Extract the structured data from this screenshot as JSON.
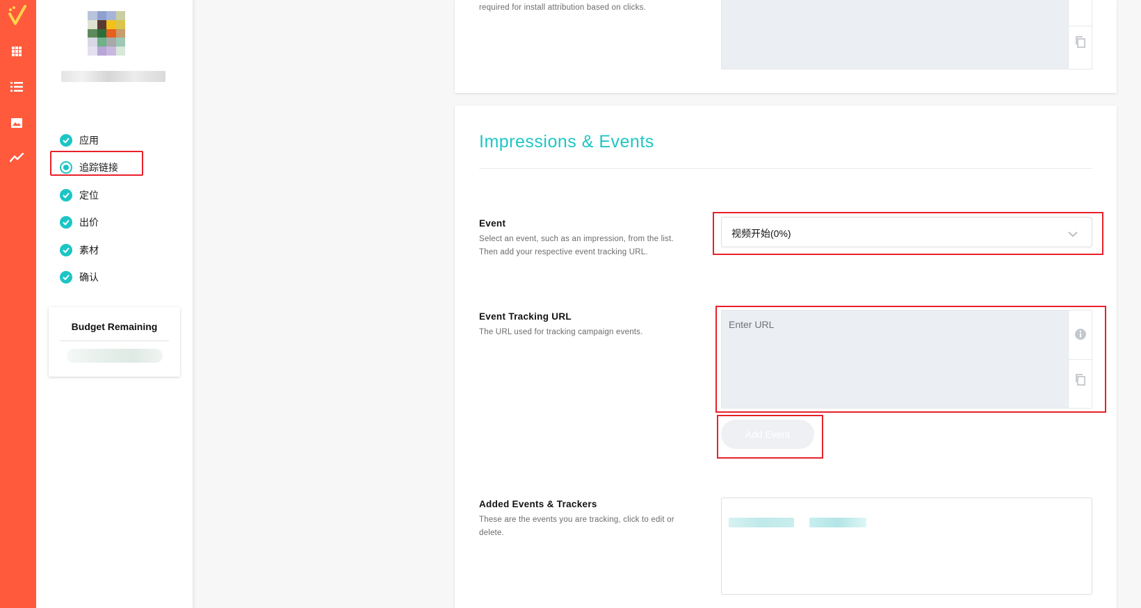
{
  "rail": {
    "icons": [
      "logo-icon",
      "grid-icon",
      "list-icon",
      "image-icon",
      "trend-icon"
    ],
    "color": "#ff5a3c"
  },
  "sidebar": {
    "steps": [
      {
        "label": "应用",
        "state": "done"
      },
      {
        "label": "追踪链接",
        "state": "current"
      },
      {
        "label": "定位",
        "state": "done"
      },
      {
        "label": "出价",
        "state": "done"
      },
      {
        "label": "素材",
        "state": "done"
      },
      {
        "label": "确认",
        "state": "done"
      }
    ],
    "budget": {
      "title": "Budget Remaining"
    }
  },
  "top_card": {
    "description": "required for install attribution based on clicks."
  },
  "impressions": {
    "title": "Impressions & Events",
    "event": {
      "label": "Event",
      "help": "Select an event, such as an impression, from the list. Then add your respective event tracking URL.",
      "selected": "视频开始(0%)"
    },
    "tracking_url": {
      "label": "Event Tracking URL",
      "help": "The URL used for tracking campaign events.",
      "placeholder": "Enter URL"
    },
    "add_button": "Add Event",
    "added": {
      "label": "Added Events & Trackers",
      "help": "These are the events you are tracking, click to edit or delete."
    }
  },
  "colors": {
    "accent": "#1fc5c5",
    "highlight": "#e8202a"
  }
}
